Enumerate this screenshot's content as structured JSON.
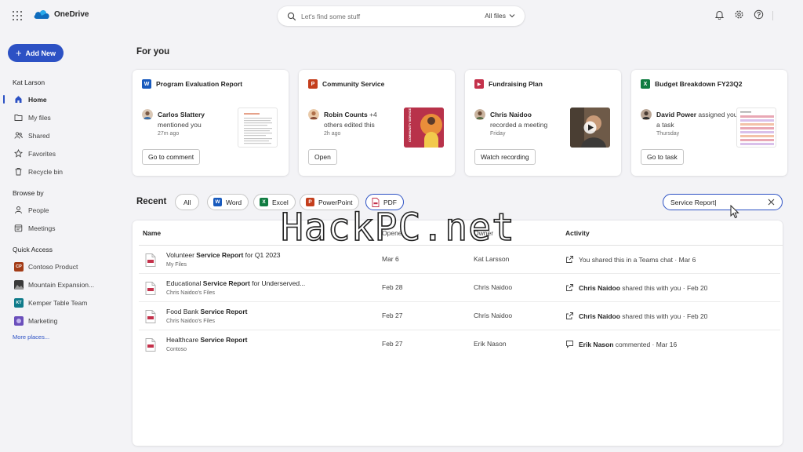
{
  "app": {
    "name": "OneDrive",
    "brand_color": "#2c51c4"
  },
  "search": {
    "placeholder": "Let's find some stuff",
    "scope": "All files"
  },
  "top_icons": [
    "bell-icon",
    "gear-icon",
    "help-icon"
  ],
  "sidebar": {
    "add_new": "Add New",
    "user": "Kat Larson",
    "main_items": [
      {
        "label": "Home",
        "icon": "home-icon",
        "active": true
      },
      {
        "label": "My files",
        "icon": "folder-icon"
      },
      {
        "label": "Shared",
        "icon": "people-icon"
      },
      {
        "label": "Favorites",
        "icon": "star-icon"
      },
      {
        "label": "Recycle bin",
        "icon": "trash-icon"
      }
    ],
    "browse_by_title": "Browse by",
    "browse_items": [
      {
        "label": "People",
        "icon": "person-icon"
      },
      {
        "label": "Meetings",
        "icon": "calendar-icon"
      }
    ],
    "quick_access_title": "Quick Access",
    "quick_items": [
      {
        "label": "Contoso Product",
        "badge": "CP",
        "color": "#a33c17"
      },
      {
        "label": "Mountain Expansion...",
        "badge": "",
        "color": "#3a3a3a"
      },
      {
        "label": "Kemper Table Team",
        "badge": "KT",
        "color": "#0f7b8a"
      },
      {
        "label": "Marketing",
        "badge": "",
        "color": "#6b4fbb"
      }
    ],
    "more_places": "More places..."
  },
  "for_you": {
    "title": "For you",
    "cards": [
      {
        "title": "Program Evaluation Report",
        "app": "W",
        "app_color": "#185abd",
        "person": "Carlos Slattery",
        "action": "mentioned you",
        "time": "27m ago",
        "button": "Go to comment"
      },
      {
        "title": "Community Service",
        "app": "P",
        "app_color": "#c43e1c",
        "person": "Robin Counts",
        "extra": "+4",
        "action": "others edited this",
        "time": "2h ago",
        "button": "Open",
        "thumb_text": "COMMUNITY SERVICE"
      },
      {
        "title": "Fundraising Plan",
        "app": "▶",
        "app_color": "#c4314b",
        "person": "Chris Naidoo",
        "action": "recorded a meeting",
        "time": "Friday",
        "button": "Watch recording"
      },
      {
        "title": "Budget Breakdown FY23Q2",
        "app": "X",
        "app_color": "#107c41",
        "person": "David Power",
        "action": "assigned you a task",
        "time": "Thursday",
        "button": "Go to task"
      }
    ]
  },
  "recent": {
    "title": "Recent",
    "filters": [
      "All",
      "Word",
      "Excel",
      "PowerPoint",
      "PDF"
    ],
    "selected_filter": "PDF",
    "filter_value": "Service Report|",
    "columns": {
      "name": "Name",
      "opened": "Opened",
      "owner": "Owner",
      "activity": "Activity"
    },
    "rows": [
      {
        "pre": "Volunteer ",
        "match": "Service Report",
        "post": " for Q1 2023",
        "location": "My Files",
        "opened": "Mar 6",
        "owner": "Kat Larsson",
        "actor": "",
        "activity": "You shared this in a Teams chat · Mar 6",
        "activity_icon": "share-icon"
      },
      {
        "pre": "Educational ",
        "match": "Service Report",
        "post": " for Underserved...",
        "location": "Chris Naidoo's Files",
        "opened": "Feb 28",
        "owner": "Chris Naidoo",
        "actor": "Chris Naidoo",
        "activity": " shared this with you · Feb 20",
        "activity_icon": "share-icon"
      },
      {
        "pre": "Food Bank ",
        "match": "Service Report",
        "post": "",
        "location": "Chris Naidoo's Files",
        "opened": "Feb 27",
        "owner": "Chris Naidoo",
        "actor": "Chris Naidoo",
        "activity": " shared this with you · Feb 20",
        "activity_icon": "share-icon"
      },
      {
        "pre": "Healthcare ",
        "match": "Service Report",
        "post": "",
        "location": "Contoso",
        "opened": "Feb 27",
        "owner": "Erik Nason",
        "actor": "Erik Nason",
        "activity": " commented · Mar 16",
        "activity_icon": "comment-icon"
      }
    ]
  },
  "watermark": "HackPC.net"
}
